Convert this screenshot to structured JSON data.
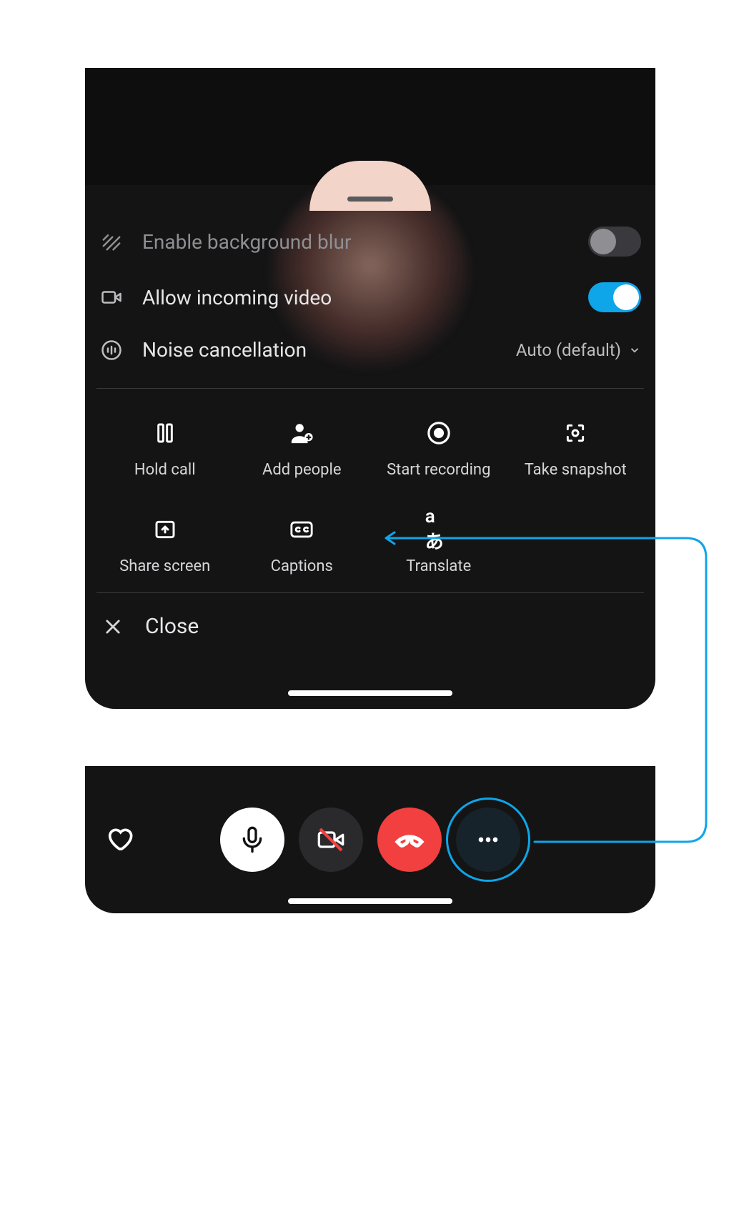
{
  "settings": {
    "bg_blur": {
      "label": "Enable background blur",
      "on": false
    },
    "incoming_video": {
      "label": "Allow incoming video",
      "on": true
    },
    "noise_cancel": {
      "label": "Noise cancellation",
      "value": "Auto (default)"
    }
  },
  "actions": {
    "hold": {
      "label": "Hold call"
    },
    "add": {
      "label": "Add people"
    },
    "record": {
      "label": "Start recording"
    },
    "snapshot": {
      "label": "Take snapshot"
    },
    "share": {
      "label": "Share screen"
    },
    "captions": {
      "label": "Captions"
    },
    "translate": {
      "label": "Translate"
    }
  },
  "close_label": "Close",
  "callbar": {
    "heart_icon": "heart-icon",
    "mic_icon": "microphone-icon",
    "camera_icon": "camera-off-icon",
    "end_icon": "end-call-icon",
    "more_icon": "more-icon"
  },
  "colors": {
    "accent": "#0ea5e9",
    "danger": "#f23f3f"
  }
}
